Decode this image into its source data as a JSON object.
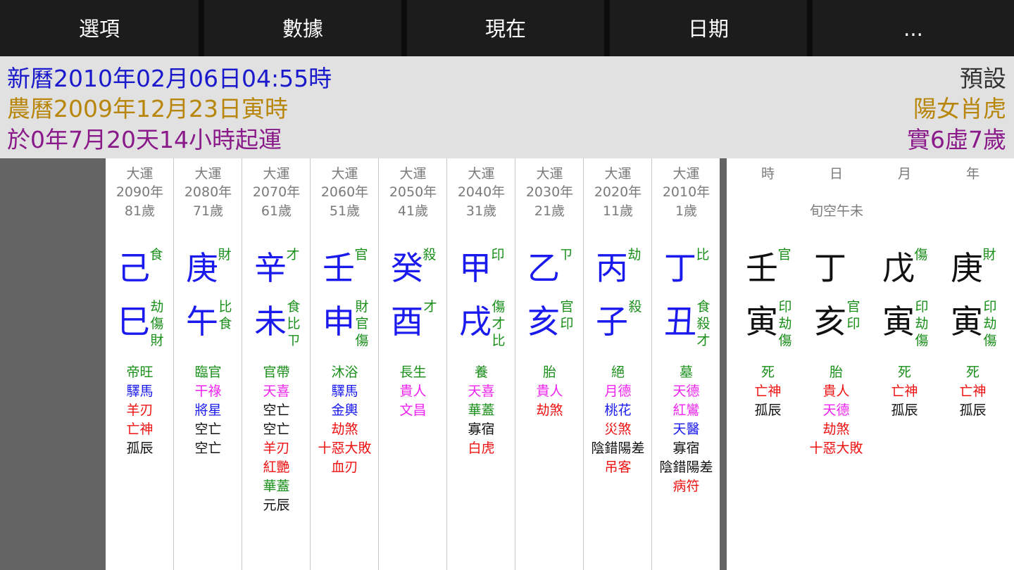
{
  "toolbar": {
    "buttons": [
      "選項",
      "數據",
      "現在",
      "日期",
      "..."
    ]
  },
  "info": {
    "solar": "新曆2010年02月06日04:55時",
    "lunar": "農曆2009年12月23日寅時",
    "luck_start": "於0年7月20天14小時起運",
    "preset": "預設",
    "gender_zodiac": "陽女肖虎",
    "age": "實6虛7歲"
  },
  "colors": {
    "toolbar_bg": "#1c1c1c",
    "info_bg": "#e1e1e1",
    "solar": "#1a1acc",
    "lunar": "#b8860b",
    "luck_start": "#8a1a8a",
    "preset": "#333333",
    "green": "#1a8f1a",
    "red": "#ee1111",
    "magenta": "#ee22ee",
    "blue": "#1a1aee",
    "black": "#111111",
    "gutter": "#646464"
  },
  "xunkong": "旬空午未",
  "luck_columns": [
    {
      "label": "大運",
      "year": "2090年",
      "age": "81歲",
      "stem": "己",
      "stem_god": "食",
      "branch": "巳",
      "branch_gods": [
        "劫",
        "傷",
        "財"
      ],
      "stars": [
        [
          "帝旺",
          "green"
        ],
        [
          "驛馬",
          "blue"
        ],
        [
          "羊刃",
          "red"
        ],
        [
          "亡神",
          "red"
        ],
        [
          "孤辰",
          "black"
        ]
      ]
    },
    {
      "label": "大運",
      "year": "2080年",
      "age": "71歲",
      "stem": "庚",
      "stem_god": "財",
      "branch": "午",
      "branch_gods": [
        "比",
        "食"
      ],
      "stars": [
        [
          "臨官",
          "green"
        ],
        [
          "干祿",
          "magenta"
        ],
        [
          "將星",
          "blue"
        ],
        [
          "空亡",
          "black"
        ],
        [
          "空亡",
          "black"
        ]
      ]
    },
    {
      "label": "大運",
      "year": "2070年",
      "age": "61歲",
      "stem": "辛",
      "stem_god": "才",
      "branch": "未",
      "branch_gods": [
        "食",
        "比",
        "ㄗ"
      ],
      "stars": [
        [
          "官帶",
          "green"
        ],
        [
          "天喜",
          "magenta"
        ],
        [
          "空亡",
          "black"
        ],
        [
          "空亡",
          "black"
        ],
        [
          "羊刃",
          "red"
        ],
        [
          "紅艷",
          "red"
        ],
        [
          "華蓋",
          "green"
        ],
        [
          "元辰",
          "black"
        ]
      ]
    },
    {
      "label": "大運",
      "year": "2060年",
      "age": "51歲",
      "stem": "壬",
      "stem_god": "官",
      "branch": "申",
      "branch_gods": [
        "財",
        "官",
        "傷"
      ],
      "stars": [
        [
          "沐浴",
          "green"
        ],
        [
          "驛馬",
          "blue"
        ],
        [
          "金輿",
          "blue"
        ],
        [
          "劫煞",
          "red"
        ],
        [
          "十惡大敗",
          "red"
        ],
        [
          "血刃",
          "red"
        ]
      ]
    },
    {
      "label": "大運",
      "year": "2050年",
      "age": "41歲",
      "stem": "癸",
      "stem_god": "殺",
      "branch": "酉",
      "branch_gods": [
        "才"
      ],
      "stars": [
        [
          "長生",
          "green"
        ],
        [
          "貴人",
          "magenta"
        ],
        [
          "文昌",
          "magenta"
        ]
      ]
    },
    {
      "label": "大運",
      "year": "2040年",
      "age": "31歲",
      "stem": "甲",
      "stem_god": "印",
      "branch": "戌",
      "branch_gods": [
        "傷",
        "才",
        "比"
      ],
      "stars": [
        [
          "養",
          "green"
        ],
        [
          "天喜",
          "magenta"
        ],
        [
          "華蓋",
          "green"
        ],
        [
          "寡宿",
          "black"
        ],
        [
          "白虎",
          "red"
        ]
      ]
    },
    {
      "label": "大運",
      "year": "2030年",
      "age": "21歲",
      "stem": "乙",
      "stem_god": "ㄗ",
      "branch": "亥",
      "branch_gods": [
        "官",
        "印"
      ],
      "stars": [
        [
          "胎",
          "green"
        ],
        [
          "貴人",
          "magenta"
        ],
        [
          "劫煞",
          "red"
        ]
      ]
    },
    {
      "label": "大運",
      "year": "2020年",
      "age": "11歲",
      "stem": "丙",
      "stem_god": "劫",
      "branch": "子",
      "branch_gods": [
        "殺"
      ],
      "stars": [
        [
          "絕",
          "green"
        ],
        [
          "月德",
          "magenta"
        ],
        [
          "桃花",
          "blue"
        ],
        [
          "災煞",
          "red"
        ],
        [
          "陰錯陽差",
          "black"
        ],
        [
          "吊客",
          "red"
        ]
      ]
    },
    {
      "label": "大運",
      "year": "2010年",
      "age": "1歲",
      "stem": "丁",
      "stem_god": "比",
      "branch": "丑",
      "branch_gods": [
        "食",
        "殺",
        "才"
      ],
      "stars": [
        [
          "墓",
          "green"
        ],
        [
          "天德",
          "magenta"
        ],
        [
          "紅鸞",
          "magenta"
        ],
        [
          "天醫",
          "blue"
        ],
        [
          "寡宿",
          "black"
        ],
        [
          "陰錯陽差",
          "black"
        ],
        [
          "病符",
          "red"
        ]
      ]
    }
  ],
  "natal_columns": [
    {
      "label": "時",
      "stem": "壬",
      "stem_god": "官",
      "branch": "寅",
      "branch_gods": [
        "印",
        "劫",
        "傷"
      ],
      "stars": [
        [
          "死",
          "green"
        ],
        [
          "亡神",
          "red"
        ],
        [
          "孤辰",
          "black"
        ]
      ]
    },
    {
      "label": "日",
      "stem": "丁",
      "stem_god": "",
      "branch": "亥",
      "branch_gods": [
        "官",
        "印"
      ],
      "stars": [
        [
          "胎",
          "green"
        ],
        [
          "貴人",
          "red"
        ],
        [
          "天德",
          "magenta"
        ],
        [
          "劫煞",
          "red"
        ],
        [
          "十惡大敗",
          "red"
        ]
      ]
    },
    {
      "label": "月",
      "stem": "戊",
      "stem_god": "傷",
      "branch": "寅",
      "branch_gods": [
        "印",
        "劫",
        "傷"
      ],
      "stars": [
        [
          "死",
          "green"
        ],
        [
          "亡神",
          "red"
        ],
        [
          "孤辰",
          "black"
        ]
      ]
    },
    {
      "label": "年",
      "stem": "庚",
      "stem_god": "財",
      "branch": "寅",
      "branch_gods": [
        "印",
        "劫",
        "傷"
      ],
      "stars": [
        [
          "死",
          "green"
        ],
        [
          "亡神",
          "red"
        ],
        [
          "孤辰",
          "black"
        ]
      ]
    }
  ]
}
